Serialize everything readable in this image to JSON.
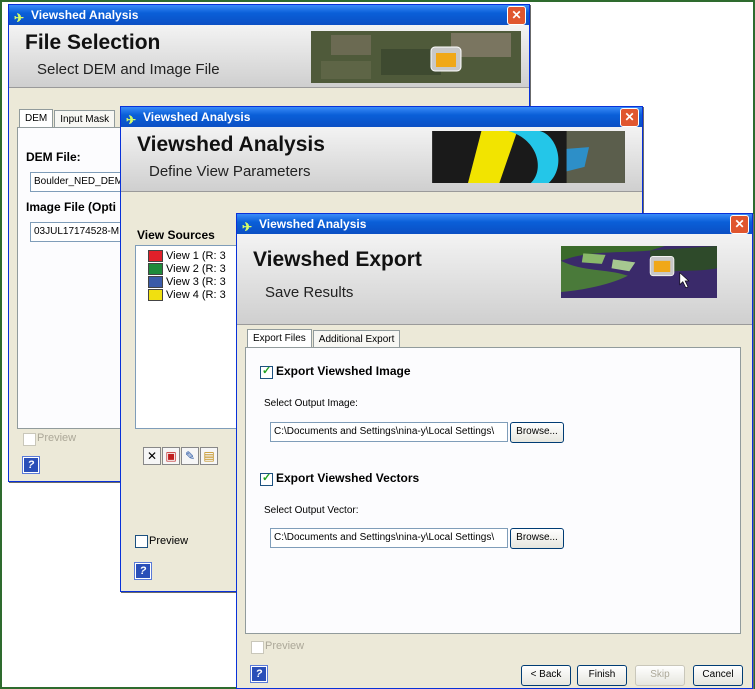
{
  "win1": {
    "title": "Viewshed Analysis",
    "header_title": "File Selection",
    "header_subtitle": "Select DEM and Image File",
    "tabs": [
      "DEM",
      "Input Mask"
    ],
    "dem_label": "DEM File:",
    "dem_value": "Boulder_NED_DEM",
    "image_label": "Image File (Opti",
    "image_value": "03JUL17174528-M",
    "preview_label": "Preview",
    "help_glyph": "?"
  },
  "win2": {
    "title": "Viewshed Analysis",
    "header_title": "Viewshed Analysis",
    "header_subtitle": "Define View Parameters",
    "sources_label": "View Sources",
    "views": [
      {
        "label": "View 1 (R: 3",
        "color": "#e0202a"
      },
      {
        "label": "View 2 (R: 3",
        "color": "#1e8a3a"
      },
      {
        "label": "View 3 (R: 3",
        "color": "#3a5aa8"
      },
      {
        "label": "View 4 (R: 3",
        "color": "#f0e010"
      }
    ],
    "preview_label": "Preview",
    "help_glyph": "?"
  },
  "win3": {
    "title": "Viewshed Analysis",
    "header_title": "Viewshed Export",
    "header_subtitle": "Save Results",
    "tabs": [
      "Export Files",
      "Additional Export"
    ],
    "export_image_label": "Export Viewshed Image",
    "select_image_label": "Select Output Image:",
    "image_path": "C:\\Documents and Settings\\nina-y\\Local Settings\\",
    "browse_label": "Browse...",
    "export_vectors_label": "Export Viewshed Vectors",
    "select_vector_label": "Select Output Vector:",
    "vector_path": "C:\\Documents and Settings\\nina-y\\Local Settings\\",
    "preview_label": "Preview",
    "back_label": "< Back",
    "finish_label": "Finish",
    "skip_label": "Skip",
    "cancel_label": "Cancel",
    "help_glyph": "?"
  },
  "colors": {
    "frame": "#2e6b2e",
    "titlebar": "#0a5fd8",
    "close": "#e0562f"
  }
}
